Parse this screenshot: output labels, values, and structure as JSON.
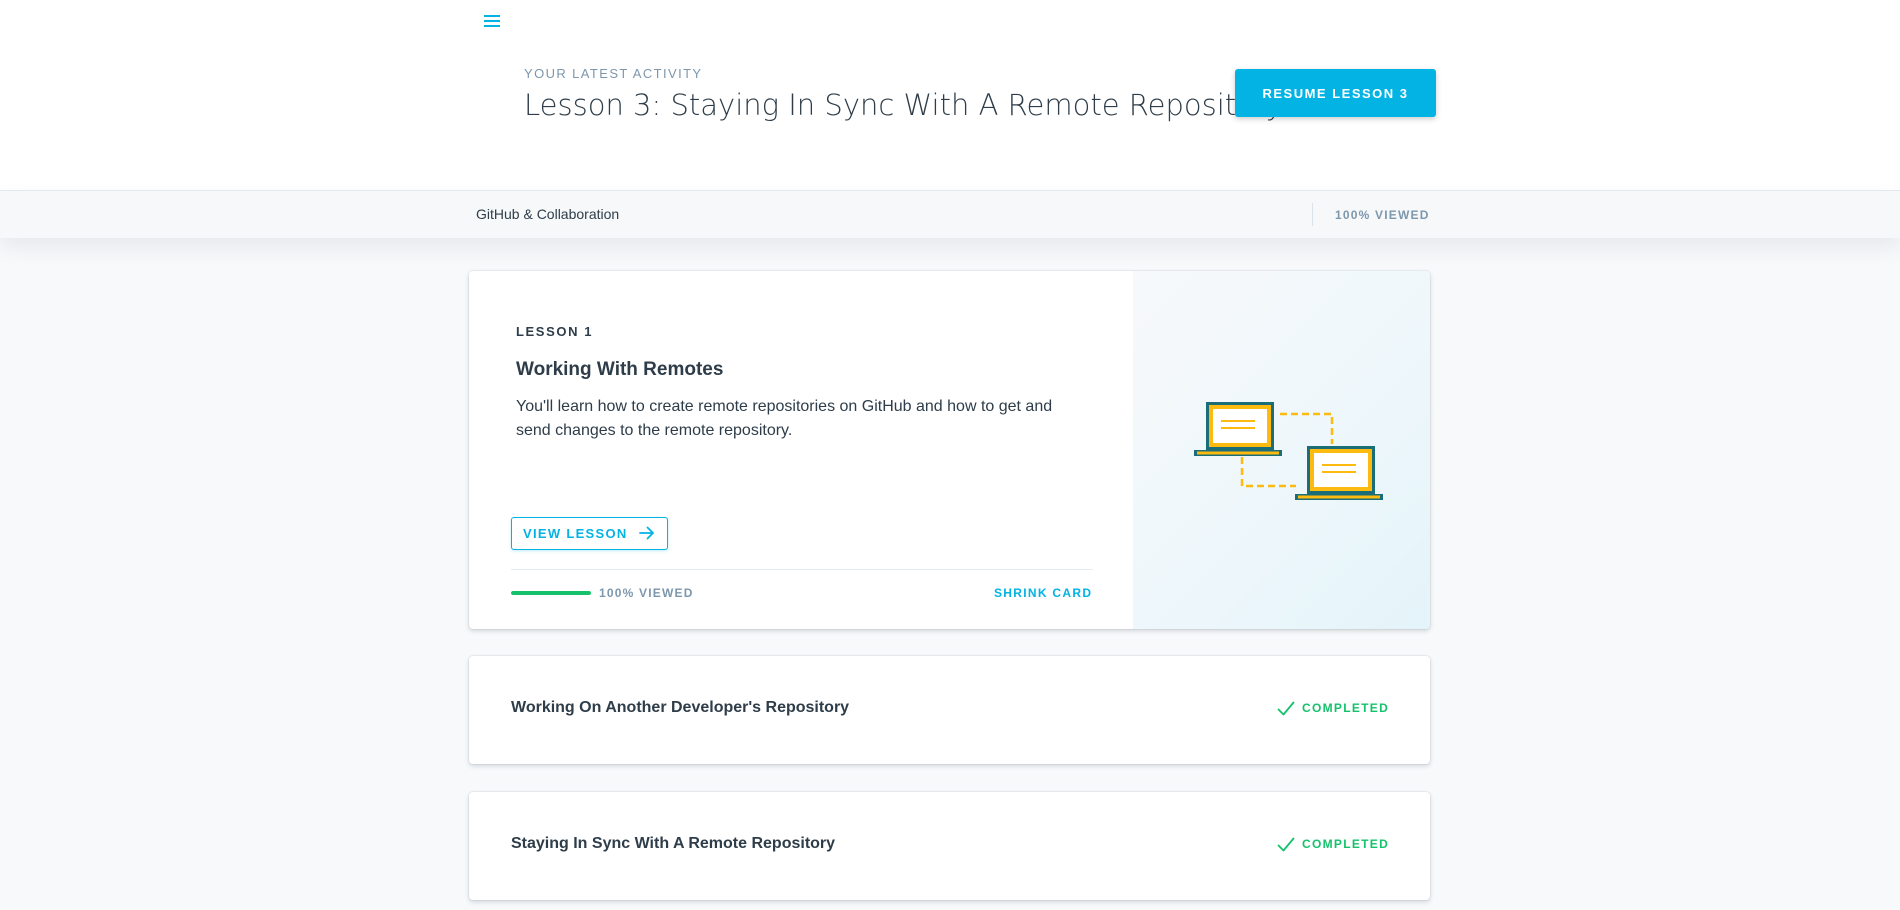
{
  "header": {
    "menu_icon": "hamburger-icon",
    "eyebrow": "YOUR LATEST ACTIVITY",
    "title": "Lesson 3: Staying In Sync With A Remote Repository",
    "resume_label": "RESUME LESSON 3"
  },
  "subbar": {
    "course_name": "GitHub & Collaboration",
    "viewed": "100% VIEWED"
  },
  "lesson_card": {
    "label": "LESSON 1",
    "title": "Working With Remotes",
    "description": "You'll learn how to create remote repositories on GitHub and how to get and send changes to the remote repository.",
    "view_label": "VIEW LESSON",
    "progress_percent": 100,
    "viewed": "100% VIEWED",
    "shrink_label": "SHRINK CARD",
    "illustration": "two-laptops-sync-illustration",
    "colors": {
      "accent": "#02b3e4",
      "progress": "#15c26b",
      "laptop_outline": "#1b6e78",
      "laptop_yellow": "#fdbb10"
    }
  },
  "lessons": [
    {
      "title": "Working On Another Developer's Repository",
      "status": "COMPLETED",
      "status_icon": "checkmark-icon"
    },
    {
      "title": "Staying In Sync With A Remote Repository",
      "status": "COMPLETED",
      "status_icon": "checkmark-icon"
    }
  ]
}
